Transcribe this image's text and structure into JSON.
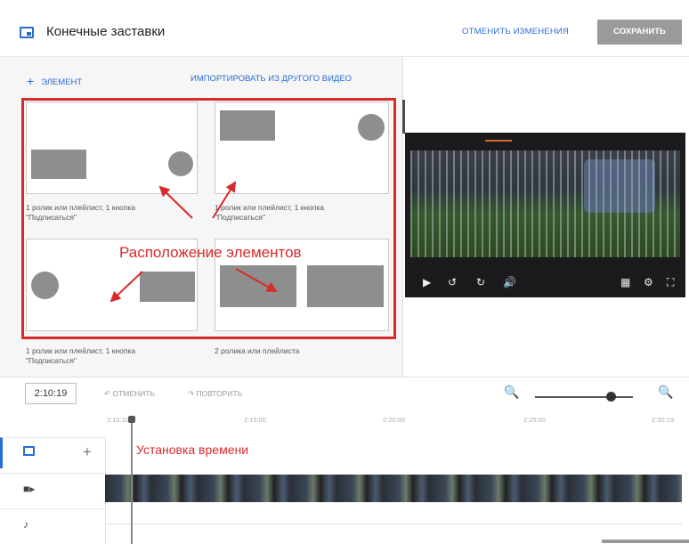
{
  "header": {
    "title": "Конечные заставки",
    "discard_label": "ОТМЕНИТЬ ИЗМЕНЕНИЯ",
    "save_label": "СОХРАНИТЬ"
  },
  "left_panel": {
    "add_element_label": "ЭЛЕМЕНТ",
    "import_label": "ИМПОРТИРОВАТЬ ИЗ ДРУГОГО ВИДЕО",
    "templates": [
      {
        "caption_line1": "1 ролик или плейлист, 1 кнопка",
        "caption_line2": "\"Подписаться\""
      },
      {
        "caption_line1": "1 ролик или плейлист, 1 кнопка",
        "caption_line2": "\"Подписаться\""
      },
      {
        "caption_line1": "1 ролик или плейлист, 1 кнопка",
        "caption_line2": "\"Подписаться\""
      },
      {
        "caption_line1": "2 ролика или плейлиста",
        "caption_line2": ""
      }
    ],
    "annotation_label": "Расположение элементов"
  },
  "toolbar": {
    "current_time": "2:10:19",
    "undo_label": "ОТМЕНИТЬ",
    "redo_label": "ПОВТОРИТЬ",
    "zoom_level": 0.78
  },
  "timeline": {
    "ruler_ticks": [
      "2:10:10",
      "2:15:00",
      "2:20:00",
      "2:25:00",
      "2:30:19"
    ],
    "annotation_label": "Установка времени"
  },
  "colors": {
    "accent": "#2a6cd6",
    "annotation": "#d92a2a",
    "save_button": "#9a9a9a"
  }
}
